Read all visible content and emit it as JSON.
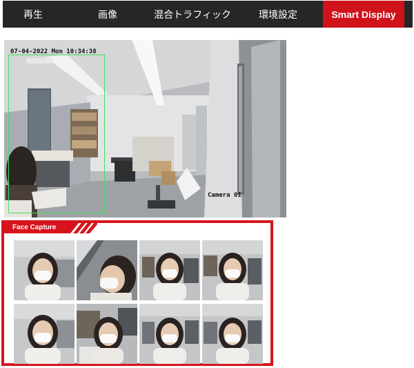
{
  "nav": {
    "tabs": [
      {
        "label": "再生",
        "active": false
      },
      {
        "label": "画像",
        "active": false
      },
      {
        "label": "混合トラフィック",
        "active": false
      },
      {
        "label": "環境設定",
        "active": false
      },
      {
        "label": "Smart Display",
        "active": true
      }
    ],
    "accent_color": "#d0121b",
    "bar_color": "#262626"
  },
  "live_view": {
    "timestamp": "07-04-2022 Mon 10:34:38",
    "camera_name": "Camera 01",
    "detection_box_color": "#3fe15a"
  },
  "face_capture": {
    "title": "Face Capture",
    "border_color": "#d7141d",
    "thumbnails": [
      {
        "row": 1,
        "col": 1
      },
      {
        "row": 1,
        "col": 2
      },
      {
        "row": 1,
        "col": 3
      },
      {
        "row": 1,
        "col": 4
      },
      {
        "row": 2,
        "col": 1
      },
      {
        "row": 2,
        "col": 2
      },
      {
        "row": 2,
        "col": 3
      },
      {
        "row": 2,
        "col": 4
      }
    ]
  }
}
